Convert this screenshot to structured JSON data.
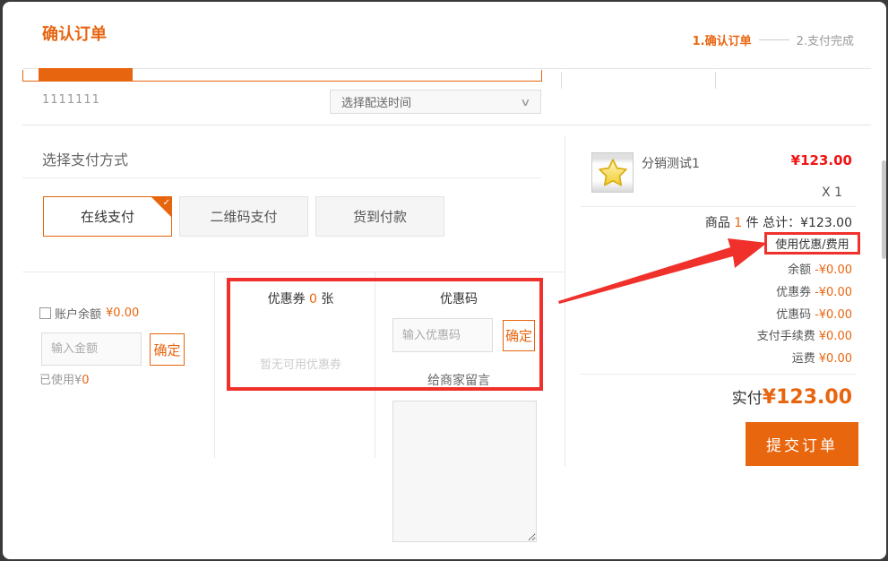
{
  "header": {
    "title": "确认订单",
    "steps": {
      "current": "1.确认订单",
      "next": "2.支付完成"
    }
  },
  "top": {
    "order_note": "1111111",
    "delivery_placeholder": "选择配送时间",
    "chevron_icon": "∨"
  },
  "payment": {
    "section_title": "选择支付方式",
    "check_icon": "✓",
    "methods": [
      {
        "label": "在线支付"
      },
      {
        "label": "二维码支付"
      },
      {
        "label": "货到付款"
      }
    ]
  },
  "balance": {
    "label": "账户余额",
    "amount": "¥0.00",
    "input_placeholder": "输入金额",
    "confirm_label": "确定",
    "used_prefix": "已使用¥",
    "used_value": "0"
  },
  "coupon": {
    "title_prefix": "优惠券 ",
    "count": "0",
    "title_suffix": " 张",
    "empty_text": "暂无可用优惠券"
  },
  "coupon_code": {
    "title": "优惠码",
    "input_placeholder": "输入优惠码",
    "confirm_label": "确定"
  },
  "message": {
    "label": "给商家留言"
  },
  "order": {
    "product_name": "分销测试1",
    "product_price": "¥123.00",
    "quantity": "X 1",
    "summary_prefix": "商品 ",
    "summary_count": "1",
    "summary_suffix": " 件 总计：¥123.00",
    "fees_link_label": "使用优惠/费用",
    "fees": [
      {
        "label": "余额",
        "value": "-¥0.00"
      },
      {
        "label": "优惠券",
        "value": "-¥0.00"
      },
      {
        "label": "优惠码",
        "value": "-¥0.00"
      },
      {
        "label": "支付手续费",
        "value": "¥0.00"
      },
      {
        "label": "运费",
        "value": "¥0.00"
      }
    ],
    "total_label": "实付",
    "total_value": "¥123.00",
    "submit_label": "提交订单"
  },
  "icons": {
    "star_icon": "★"
  },
  "colors": {
    "accent_orange": "#e8650f",
    "price_red": "#f01414",
    "annotation_red": "#f0312b"
  }
}
